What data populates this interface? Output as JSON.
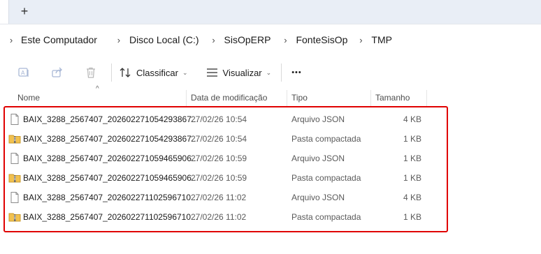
{
  "tabbar": {
    "new_tab": "+"
  },
  "breadcrumb": {
    "chevron": "›",
    "items": [
      "Este Computador",
      "Disco Local (C:)",
      "SisOpERP",
      "FonteSisOp",
      "TMP"
    ]
  },
  "toolbar": {
    "sort_label": "Classificar",
    "view_label": "Visualizar",
    "more_label": "•••",
    "caret": "⌄"
  },
  "columns": {
    "name": "Nome",
    "date": "Data de modificação",
    "type": "Tipo",
    "size": "Tamanho",
    "sort_indicator": "^"
  },
  "files": [
    {
      "name": "BAIX_3288_2567407_202602271054293867...",
      "date": "27/02/26 10:54",
      "type": "Arquivo JSON",
      "size": "4 KB",
      "icon": "json-file-icon"
    },
    {
      "name": "BAIX_3288_2567407_202602271054293867...",
      "date": "27/02/26 10:54",
      "type": "Pasta compactada",
      "size": "1 KB",
      "icon": "zip-folder-icon"
    },
    {
      "name": "BAIX_3288_2567407_202602271059465906...",
      "date": "27/02/26 10:59",
      "type": "Arquivo JSON",
      "size": "1 KB",
      "icon": "json-file-icon"
    },
    {
      "name": "BAIX_3288_2567407_202602271059465906...",
      "date": "27/02/26 10:59",
      "type": "Pasta compactada",
      "size": "1 KB",
      "icon": "zip-folder-icon"
    },
    {
      "name": "BAIX_3288_2567407_202602271102596710...",
      "date": "27/02/26 11:02",
      "type": "Arquivo JSON",
      "size": "4 KB",
      "icon": "json-file-icon"
    },
    {
      "name": "BAIX_3288_2567407_202602271102596710...",
      "date": "27/02/26 11:02",
      "type": "Pasta compactada",
      "size": "1 KB",
      "icon": "zip-folder-icon"
    }
  ],
  "colors": {
    "highlight": "#e00000",
    "tabbar": "#e9eef6",
    "folder": "#f2c14e"
  }
}
